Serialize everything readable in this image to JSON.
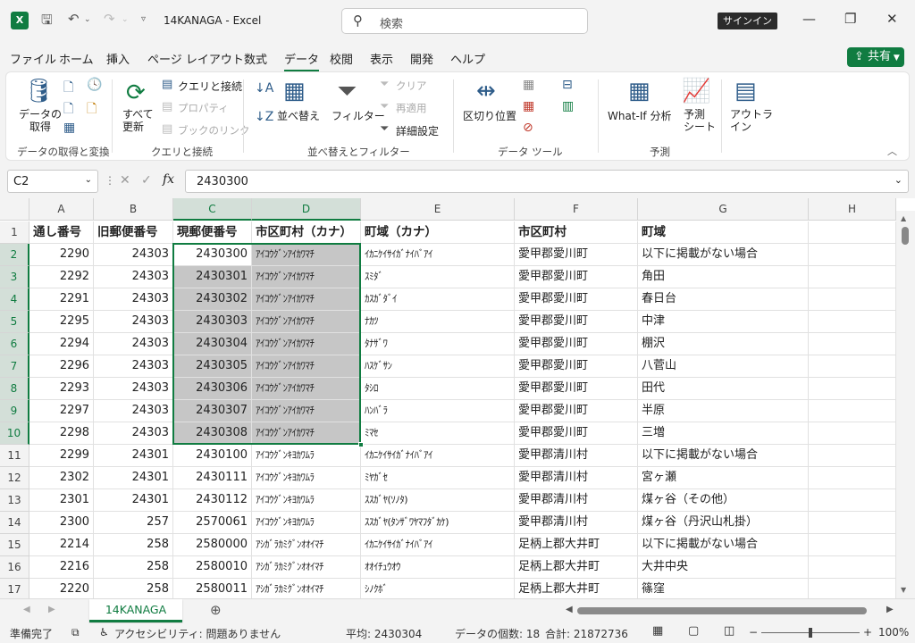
{
  "titlebar": {
    "title": "14KANAGA  -  Excel",
    "search_placeholder": "検索",
    "signin": "サインイン"
  },
  "menu": [
    "ファイル",
    "ホーム",
    "挿入",
    "ページ レイアウト",
    "数式",
    "データ",
    "校閲",
    "表示",
    "開発",
    "ヘルプ"
  ],
  "share": "共有",
  "ribbon": {
    "get_data": "データの\n取得",
    "refresh_all": "すべて\n更新",
    "queries": "クエリと接続",
    "properties": "プロパティ",
    "edit_links": "ブックのリンク",
    "sort": "並べ替え",
    "filter": "フィルター",
    "clear": "クリア",
    "reapply": "再適用",
    "advanced": "詳細設定",
    "text_to_columns": "区切り位置",
    "whatif": "What-If 分析",
    "forecast_sheet": "予測\nシート",
    "outline": "アウトラ\nイン",
    "groups": [
      "データの取得と変換",
      "クエリと接続",
      "並べ替えとフィルター",
      "データ ツール",
      "予測"
    ]
  },
  "formula": {
    "namebox": "C2",
    "value": "2430300"
  },
  "columns": [
    "A",
    "B",
    "C",
    "D",
    "E",
    "F",
    "G",
    "H"
  ],
  "headers": [
    "通し番号",
    "旧郵便番号",
    "現郵便番号",
    "市区町村（カナ）",
    "町域（カナ）",
    "市区町村",
    "町域"
  ],
  "rows": [
    [
      "2290",
      "24303",
      "2430300",
      "ｱｲｺｳｸﾞﾝｱｲｶﾜﾏﾁ",
      "ｲｶﾆｹｲｻｲｶﾞﾅｲﾊﾞｱｲ",
      "愛甲郡愛川町",
      "以下に掲載がない場合"
    ],
    [
      "2292",
      "24303",
      "2430301",
      "ｱｲｺｳｸﾞﾝｱｲｶﾜﾏﾁ",
      "ｽﾐﾀﾞ",
      "愛甲郡愛川町",
      "角田"
    ],
    [
      "2291",
      "24303",
      "2430302",
      "ｱｲｺｳｸﾞﾝｱｲｶﾜﾏﾁ",
      "ｶｽｶﾞﾀﾞｲ",
      "愛甲郡愛川町",
      "春日台"
    ],
    [
      "2295",
      "24303",
      "2430303",
      "ｱｲｺｳｸﾞﾝｱｲｶﾜﾏﾁ",
      "ﾅｶﾂ",
      "愛甲郡愛川町",
      "中津"
    ],
    [
      "2294",
      "24303",
      "2430304",
      "ｱｲｺｳｸﾞﾝｱｲｶﾜﾏﾁ",
      "ﾀﾅｻﾞﾜ",
      "愛甲郡愛川町",
      "棚沢"
    ],
    [
      "2296",
      "24303",
      "2430305",
      "ｱｲｺｳｸﾞﾝｱｲｶﾜﾏﾁ",
      "ﾊｽｹﾞｻﾝ",
      "愛甲郡愛川町",
      "八菅山"
    ],
    [
      "2293",
      "24303",
      "2430306",
      "ｱｲｺｳｸﾞﾝｱｲｶﾜﾏﾁ",
      "ﾀｼﾛ",
      "愛甲郡愛川町",
      "田代"
    ],
    [
      "2297",
      "24303",
      "2430307",
      "ｱｲｺｳｸﾞﾝｱｲｶﾜﾏﾁ",
      "ﾊﾝﾊﾞﾗ",
      "愛甲郡愛川町",
      "半原"
    ],
    [
      "2298",
      "24303",
      "2430308",
      "ｱｲｺｳｸﾞﾝｱｲｶﾜﾏﾁ",
      "ﾐﾏｾ",
      "愛甲郡愛川町",
      "三増"
    ],
    [
      "2299",
      "24301",
      "2430100",
      "ｱｲｺｳｸﾞﾝｷﾖｶﾜﾑﾗ",
      "ｲｶﾆｹｲｻｲｶﾞﾅｲﾊﾞｱｲ",
      "愛甲郡清川村",
      "以下に掲載がない場合"
    ],
    [
      "2302",
      "24301",
      "2430111",
      "ｱｲｺｳｸﾞﾝｷﾖｶﾜﾑﾗ",
      "ﾐﾔｶﾞｾ",
      "愛甲郡清川村",
      "宮ヶ瀬"
    ],
    [
      "2301",
      "24301",
      "2430112",
      "ｱｲｺｳｸﾞﾝｷﾖｶﾜﾑﾗ",
      "ｽｽｶﾞﾔ(ｿﾉﾀ)",
      "愛甲郡清川村",
      "煤ヶ谷（その他）"
    ],
    [
      "2300",
      "257",
      "2570061",
      "ｱｲｺｳｸﾞﾝｷﾖｶﾜﾑﾗ",
      "ｽｽｶﾞﾔ(ﾀﾝｻﾞﾜﾔﾏﾌﾀﾞｶｹ)",
      "愛甲郡清川村",
      "煤ヶ谷（丹沢山札掛）"
    ],
    [
      "2214",
      "258",
      "2580000",
      "ｱｼｶﾞﾗｶﾐｸﾞﾝｵｵｲﾏﾁ",
      "ｲｶﾆｹｲｻｲｶﾞﾅｲﾊﾞｱｲ",
      "足柄上郡大井町",
      "以下に掲載がない場合"
    ],
    [
      "2216",
      "258",
      "2580010",
      "ｱｼｶﾞﾗｶﾐｸﾞﾝｵｵｲﾏﾁ",
      "ｵｵｲﾁｭｳｵｳ",
      "足柄上郡大井町",
      "大井中央"
    ],
    [
      "2220",
      "258",
      "2580011",
      "ｱｼｶﾞﾗｶﾐｸﾞﾝｵｵｲﾏﾁ",
      "ｼﾉｸﾎﾞ",
      "足柄上郡大井町",
      "篠窪"
    ]
  ],
  "sheet_tab": "14KANAGA",
  "status": {
    "ready": "準備完了",
    "accessibility": "アクセシビリティ: 問題ありません",
    "average": "平均: 2430304",
    "count": "データの個数: 18",
    "sum": "合計: 21872736",
    "zoom": "100%"
  }
}
